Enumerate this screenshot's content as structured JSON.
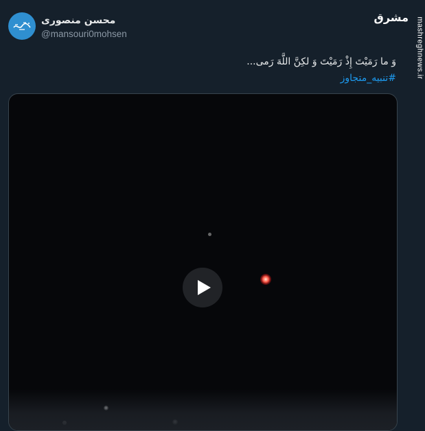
{
  "tweet": {
    "author_name": "محسن منصوری",
    "author_handle": "@mansouri0mohsen",
    "text": "وَ ما رَمَيْتَ إِذْ رَمَيْتَ وَ لكِنَّ اللَّهَ رَمى...",
    "hashtag": "#تنبیه_متجاوز"
  },
  "media": {
    "type": "video",
    "play_icon": "play-icon"
  },
  "watermark": {
    "logo": "مشرق",
    "site": "mashreghnews.ir"
  },
  "colors": {
    "background": "#15202b",
    "primary_text": "#e7e9ea",
    "secondary_text": "#8b98a5",
    "link": "#1d9bf0",
    "avatar": "#2f8fd0"
  }
}
